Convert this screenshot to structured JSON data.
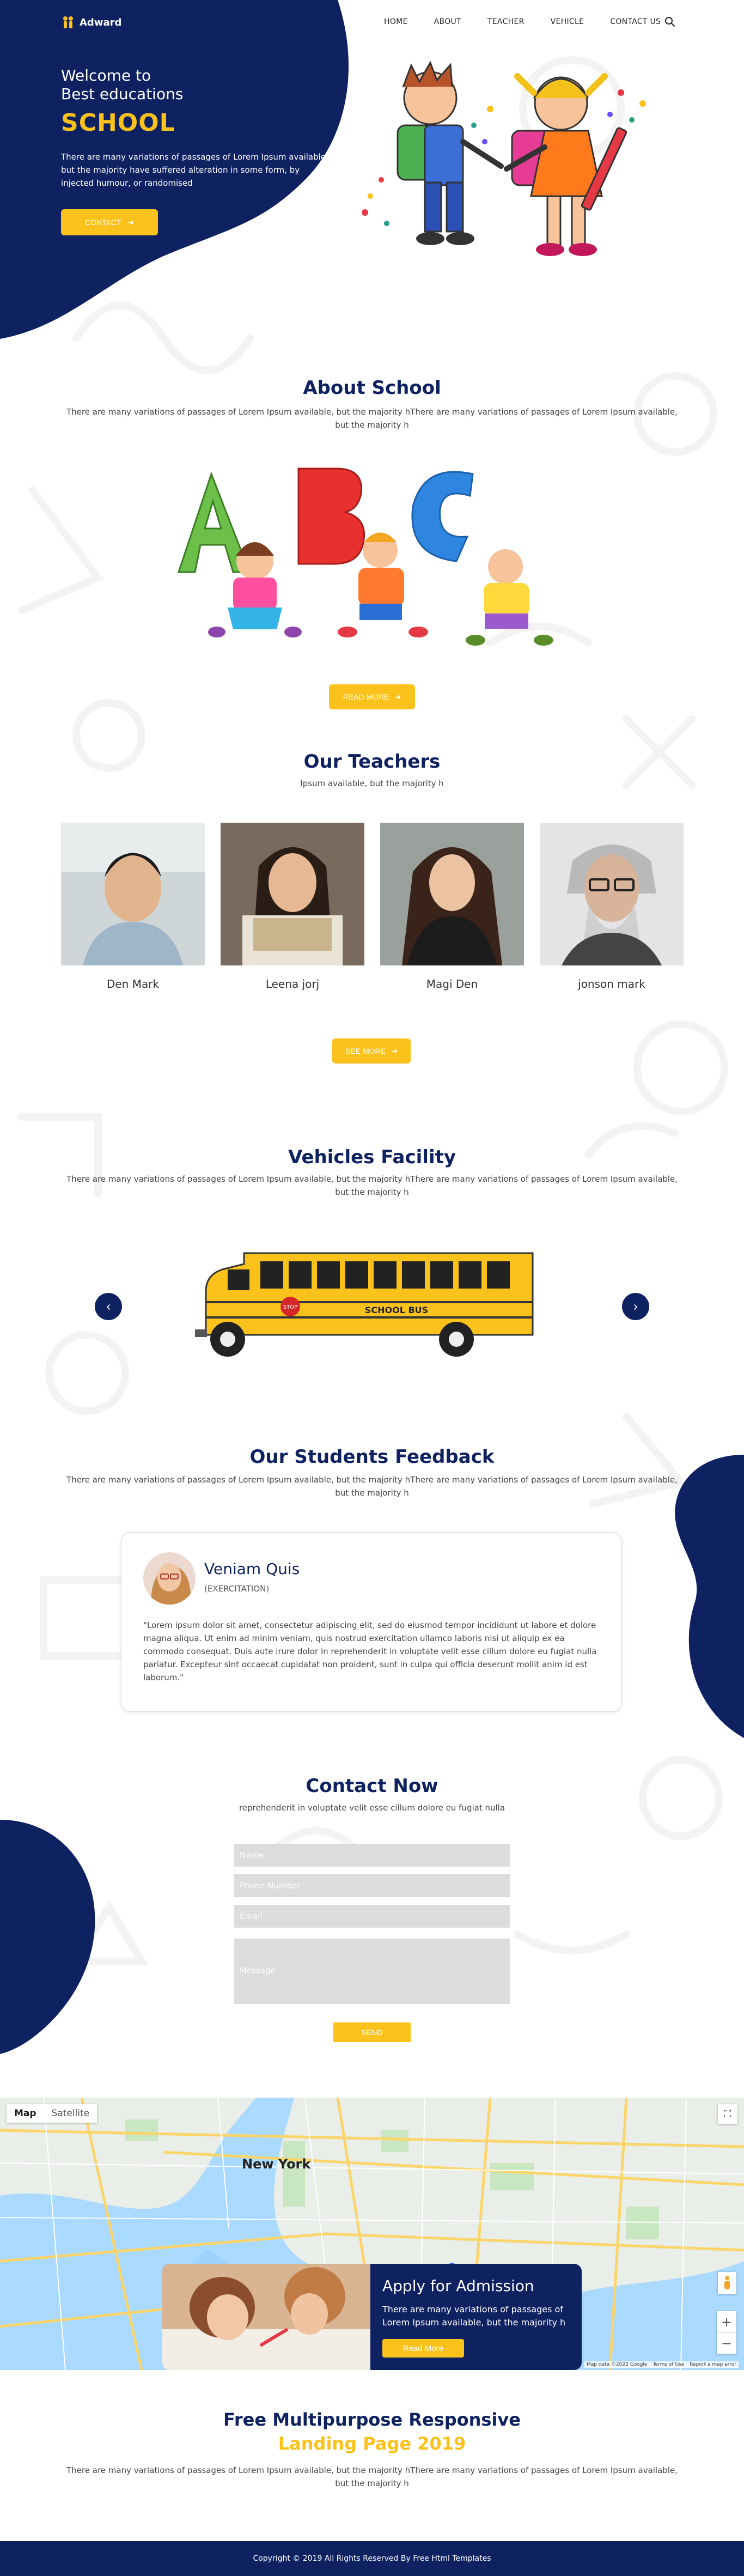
{
  "brand": {
    "name": "Adward"
  },
  "nav": {
    "items": [
      "HOME",
      "ABOUT",
      "TEACHER",
      "VEHICLE",
      "CONTACT US"
    ],
    "search_icon": "search-icon"
  },
  "hero": {
    "welcome_line1": "Welcome to",
    "welcome_line2": "Best educations",
    "school": "SCHOOL",
    "text": "There are many variations of passages of Lorem Ipsum available, but the majority have suffered alteration in some form, by injected humour, or randomised",
    "button": "CONTACT"
  },
  "about": {
    "title": "About School",
    "text": "There are many variations of passages of Lorem Ipsum available, but the majority hThere are many variations of passages of Lorem Ipsum available, but the majority h",
    "button": "READ MORE"
  },
  "teachers": {
    "title": "Our Teachers",
    "subtitle": "Ipsum available, but the majority h",
    "list": [
      {
        "name": "Den Mark"
      },
      {
        "name": "Leena jorj"
      },
      {
        "name": "Magi Den"
      },
      {
        "name": "jonson mark"
      }
    ],
    "button": "SEE MORE"
  },
  "vehicles": {
    "title": "Vehicles Facility",
    "text": "There are many variations of passages of Lorem Ipsum available, but the majority hThere are many variations of passages of Lorem Ipsum available, but the majority h",
    "bus_label": "SCHOOL BUS",
    "stop_label": "STOP"
  },
  "feedback": {
    "title": "Our Students Feedback",
    "text": "There are many variations of passages of Lorem Ipsum available, but the majority hThere are many variations of passages of Lorem Ipsum available, but the majority h",
    "name": "Veniam Quis",
    "role": "(EXERCITATION)",
    "quote": "\"Lorem ipsum dolor sit amet, consectetur adipiscing elit, sed do eiusmod tempor incididunt ut labore et dolore magna aliqua. Ut enim ad minim veniam, quis nostrud exercitation ullamco laboris nisi ut aliquip ex ea commodo consequat. Duis aute irure dolor in reprehenderit in voluptate velit esse cillum dolore eu fugiat nulla pariatur. Excepteur sint occaecat cupidatat non proident, sunt in culpa qui officia deserunt mollit anim id est laborum.\""
  },
  "contact": {
    "title": "Contact Now",
    "subtitle": "reprehenderit in voluptate velit esse cillum dolore eu fugiat nulla",
    "name_placeholder": "Name",
    "phone_placeholder": "Phone Number",
    "email_placeholder": "Email",
    "message_placeholder": "Message",
    "send": "SEND"
  },
  "map": {
    "tabs": [
      "Map",
      "Satellite"
    ],
    "city_label": "New York",
    "credits": [
      "Map data ©2022 Google",
      "Terms of Use",
      "Report a map error"
    ]
  },
  "admission": {
    "title": "Apply for Admission",
    "text": "There are many variations of passages of Lorem Ipsum available, but the majority h",
    "button": "Read More"
  },
  "promo": {
    "line1": "Free Multipurpose Responsive",
    "line2": "Landing Page 2019",
    "text": "There are many variations of passages of Lorem Ipsum available, but the majority hThere are many variations of passages of Lorem Ipsum available, but the majority h"
  },
  "footer": {
    "copyright": "Copyright © 2019 All Rights Reserved By Free Html Templates"
  },
  "colors": {
    "navy": "#0e2161",
    "yellow": "#fbc21b",
    "field_gray": "#dcdcdc"
  }
}
